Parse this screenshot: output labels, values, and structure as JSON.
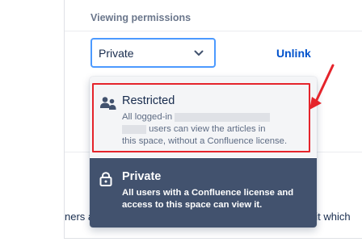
{
  "settings": {
    "section_label": "Viewing permissions",
    "select_value": "Private",
    "unlink_label": "Unlink"
  },
  "background_text": {
    "left": "ners a",
    "right": "nit which"
  },
  "menu": {
    "options": [
      {
        "title": "Restricted",
        "desc_line1": "All logged-in",
        "desc_line2_suffix": "users can view the articles in",
        "desc_line3": "this space, without a Confluence license.",
        "icon": "people-icon"
      },
      {
        "title": "Private",
        "desc_line1": "All users with a Confluence license and",
        "desc_line2": "access to this space can view it.",
        "icon": "lock-icon"
      }
    ]
  },
  "annotation": {
    "color": "#e5242b"
  }
}
